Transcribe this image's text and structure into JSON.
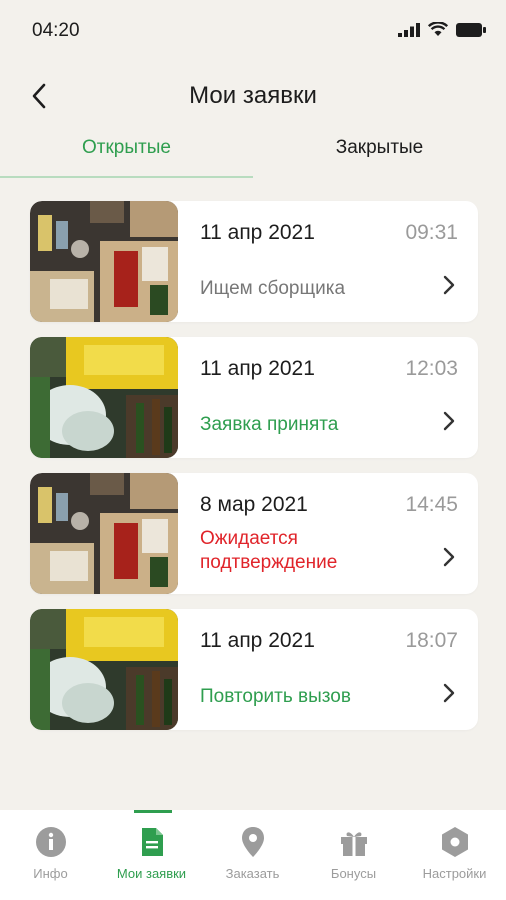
{
  "status_bar": {
    "time": "04:20"
  },
  "header": {
    "title": "Мои заявки"
  },
  "tabs": [
    {
      "label": "Открытые",
      "active": true
    },
    {
      "label": "Закрытые",
      "active": false
    }
  ],
  "orders": [
    {
      "date": "11 апр 2021",
      "time": "09:31",
      "status": "Ищем сборщика",
      "status_color": "#777777",
      "photo": "mixed-recyclables-photo"
    },
    {
      "date": "11 апр 2021",
      "time": "12:03",
      "status": "Заявка принята",
      "status_color": "#2f9e4f",
      "photo": "bottles-crate-photo"
    },
    {
      "date": "8 мар 2021",
      "time": "14:45",
      "status": "Ожидается подтверждение",
      "status_line1": "Ожидается",
      "status_line2": "подтверждение",
      "status_color": "#e0242a",
      "photo": "mixed-recyclables-photo"
    },
    {
      "date": "11 апр 2021",
      "time": "18:07",
      "status": "Повторить вызов",
      "status_color": "#2f9e4f",
      "photo": "bottles-crate-photo"
    }
  ],
  "bottom_nav": [
    {
      "label": "Инфо",
      "icon": "info-icon",
      "active": false
    },
    {
      "label": "Мои заявки",
      "icon": "document-icon",
      "active": true
    },
    {
      "label": "Заказать",
      "icon": "location-pin-icon",
      "active": false
    },
    {
      "label": "Бонусы",
      "icon": "gift-icon",
      "active": false
    },
    {
      "label": "Настройки",
      "icon": "settings-hexagon-icon",
      "active": false
    }
  ],
  "colors": {
    "accent": "#2f9e4f",
    "background": "#f3f1ec",
    "alert": "#e0242a",
    "muted": "#9a9a9a"
  }
}
